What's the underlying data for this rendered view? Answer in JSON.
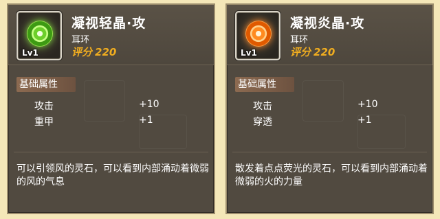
{
  "cards": [
    {
      "name": "凝视轻晶·攻",
      "slot": "耳环",
      "level": "Lv1",
      "score_label": "评分",
      "score_value": "220",
      "gem_color": "#6ccf2a",
      "icon": "green-spirit-stone-icon",
      "section_title": "基础属性",
      "attributes": [
        {
          "label": "攻击",
          "value": "+10"
        },
        {
          "label": "重甲",
          "value": "+1"
        }
      ],
      "description": "可以引领风的灵石，可以看到内部涌动着微弱的风的气息"
    },
    {
      "name": "凝视炎晶·攻",
      "slot": "耳环",
      "level": "Lv1",
      "score_label": "评分",
      "score_value": "220",
      "gem_color": "#ff8a1f",
      "icon": "orange-spirit-stone-icon",
      "section_title": "基础属性",
      "attributes": [
        {
          "label": "攻击",
          "value": "+10"
        },
        {
          "label": "穿透",
          "value": "+1"
        }
      ],
      "description": "散发着点点荧光的灵石，可以看到内部涌动着微弱的火的力量"
    }
  ]
}
